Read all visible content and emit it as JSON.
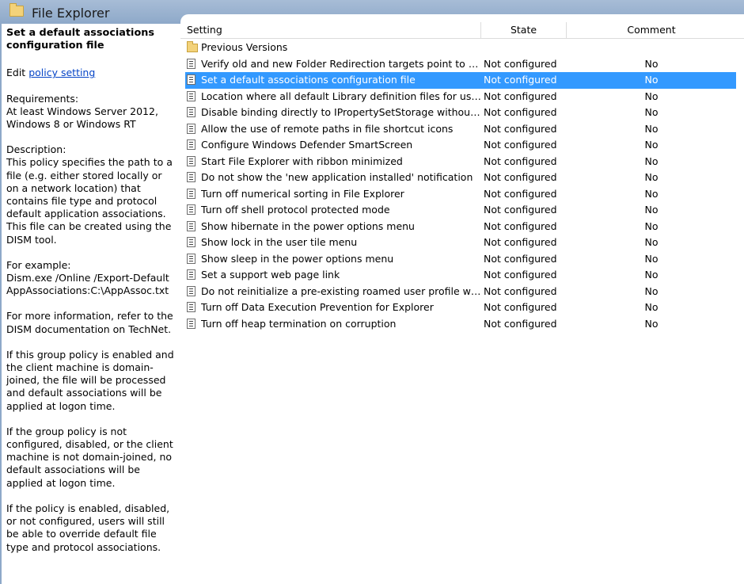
{
  "window": {
    "title": "File Explorer"
  },
  "left": {
    "policy_title": "Set a default associations configuration file",
    "edit_prefix": "Edit ",
    "edit_link": "policy setting",
    "requirements": "Requirements:\nAt least Windows Server 2012, Windows 8 or Windows RT",
    "description": "Description:\nThis policy specifies the path to a file (e.g. either stored locally or on a network location) that contains file type and protocol default application associations. This file can be created using the DISM tool.",
    "example": "For example:\nDism.exe /Online /Export-DefaultAppAssociations:C:\\AppAssoc.txt",
    "more_info": "For more information, refer to the DISM documentation on TechNet.",
    "enabled_text": "If this group policy is enabled and the client machine is domain-joined, the file will be processed and default associations will be applied at logon time.",
    "not_configured_text": "If the group policy is not configured, disabled, or the client machine is not domain-joined, no default associations will be applied at logon time.",
    "override_text": "If the policy is enabled, disabled, or not configured, users will still be able to override default file type and protocol associations."
  },
  "table": {
    "headers": {
      "setting": "Setting",
      "state": "State",
      "comment": "Comment"
    },
    "rows": [
      {
        "icon": "folder-icon",
        "name": "Previous Versions",
        "state": "",
        "comment": ""
      },
      {
        "icon": "policy-doc-icon",
        "name": "Verify old and new Folder Redirection targets point to the sa...",
        "state": "Not configured",
        "comment": "No"
      },
      {
        "icon": "policy-doc-icon",
        "name": "Set a default associations configuration file",
        "state": "Not configured",
        "comment": "No",
        "selected": true
      },
      {
        "icon": "policy-doc-icon",
        "name": "Location where all default Library definition files for users/m...",
        "state": "Not configured",
        "comment": "No"
      },
      {
        "icon": "policy-doc-icon",
        "name": "Disable binding directly to IPropertySetStorage without inter...",
        "state": "Not configured",
        "comment": "No"
      },
      {
        "icon": "policy-doc-icon",
        "name": "Allow the use of remote paths in file shortcut icons",
        "state": "Not configured",
        "comment": "No"
      },
      {
        "icon": "policy-doc-icon",
        "name": "Configure Windows Defender SmartScreen",
        "state": "Not configured",
        "comment": "No"
      },
      {
        "icon": "policy-doc-icon",
        "name": "Start File Explorer with ribbon minimized",
        "state": "Not configured",
        "comment": "No"
      },
      {
        "icon": "policy-doc-icon",
        "name": "Do not show the 'new application installed' notification",
        "state": "Not configured",
        "comment": "No"
      },
      {
        "icon": "policy-doc-icon",
        "name": "Turn off numerical sorting in File Explorer",
        "state": "Not configured",
        "comment": "No"
      },
      {
        "icon": "policy-doc-icon",
        "name": "Turn off shell protocol protected mode",
        "state": "Not configured",
        "comment": "No"
      },
      {
        "icon": "policy-doc-icon",
        "name": "Show hibernate in the power options menu",
        "state": "Not configured",
        "comment": "No"
      },
      {
        "icon": "policy-doc-icon",
        "name": "Show lock in the user tile menu",
        "state": "Not configured",
        "comment": "No"
      },
      {
        "icon": "policy-doc-icon",
        "name": "Show sleep in the power options menu",
        "state": "Not configured",
        "comment": "No"
      },
      {
        "icon": "policy-doc-icon",
        "name": "Set a support web page link",
        "state": "Not configured",
        "comment": "No"
      },
      {
        "icon": "policy-doc-icon",
        "name": "Do not reinitialize a pre-existing roamed user profile when it ...",
        "state": "Not configured",
        "comment": "No"
      },
      {
        "icon": "policy-doc-icon",
        "name": "Turn off Data Execution Prevention for Explorer",
        "state": "Not configured",
        "comment": "No"
      },
      {
        "icon": "policy-doc-icon",
        "name": "Turn off heap termination on corruption",
        "state": "Not configured",
        "comment": "No"
      }
    ]
  },
  "colors": {
    "selection": "#3399ff",
    "titlebar": "#8ea9c9",
    "link": "#0645c7"
  }
}
